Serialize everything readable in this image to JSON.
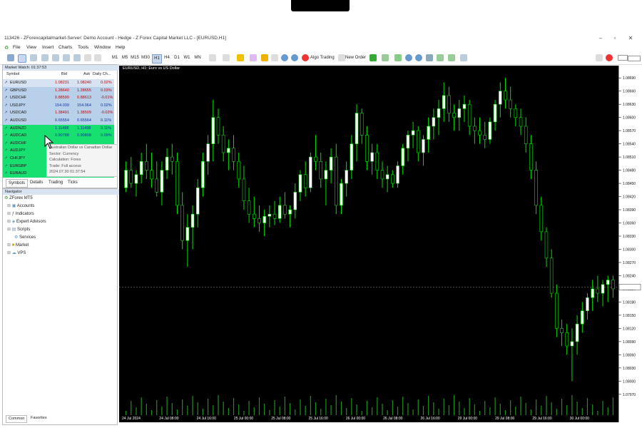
{
  "window": {
    "title": "113426 - ZForexcapitalmarket-Server: Demo Account - Hedge - Z Forex Capital Market LLC - [EURUSD,H1]"
  },
  "menu": [
    "File",
    "View",
    "Insert",
    "Charts",
    "Tools",
    "Window",
    "Help"
  ],
  "toolbar": {
    "timeframes": [
      "M1",
      "M5",
      "M15",
      "M30",
      "H1",
      "H4",
      "D1",
      "W1",
      "MN"
    ],
    "algo": "Algo Trading",
    "new_order": "New Order"
  },
  "market_watch": {
    "title": "Market Watch: 01:37:53",
    "headers": [
      "Symbol",
      "Bid",
      "Ask",
      "Daily Ch..."
    ],
    "rows": [
      {
        "symbol": "EURUSD",
        "bid": "1.08231",
        "ask": "1.08240",
        "change": "0.02%",
        "color": "#d7e3f2",
        "textcolor": "#c00000"
      },
      {
        "symbol": "GBPUSD",
        "bid": "1.28640",
        "ask": "1.28655",
        "change": "0.03%",
        "color": "#b9d0ea",
        "textcolor": "#c00000"
      },
      {
        "symbol": "USDCHF",
        "bid": "0.88599",
        "ask": "0.88613",
        "change": "-0.01%",
        "color": "#b9d0ea",
        "textcolor": "#c00000"
      },
      {
        "symbol": "USDJPY",
        "bid": "154.039",
        "ask": "154.064",
        "change": "0.02%",
        "color": "#b9d0ea",
        "textcolor": "#1030a0"
      },
      {
        "symbol": "USDCAD",
        "bid": "1.38491",
        "ask": "1.38509",
        "change": "-0.02%",
        "color": "#b9d0ea",
        "textcolor": "#c00000"
      },
      {
        "symbol": "AUDUSD",
        "bid": "0.65554",
        "ask": "0.65564",
        "change": "0.11%",
        "color": "#b9d0ea",
        "textcolor": "#1030a0"
      },
      {
        "symbol": "AUDNZD",
        "bid": "1.11488",
        "ask": "1.11498",
        "change": "0.11%",
        "color": "#18e070",
        "textcolor": "#1030a0"
      },
      {
        "symbol": "AUDCAD",
        "bid": "0.90788",
        "ask": "0.90808",
        "change": "0.09%",
        "color": "#18e070",
        "textcolor": "#1030a0"
      },
      {
        "symbol": "AUDCHF",
        "bid": "",
        "ask": "",
        "change": "",
        "color": "#18e070",
        "textcolor": "#1030a0"
      },
      {
        "symbol": "AUDJPY",
        "bid": "",
        "ask": "",
        "change": "",
        "color": "#18e070",
        "textcolor": "#1030a0"
      },
      {
        "symbol": "CHFJPY",
        "bid": "",
        "ask": "",
        "change": "",
        "color": "#18e070",
        "textcolor": "#1030a0"
      },
      {
        "symbol": "EURGBP",
        "bid": "",
        "ask": "",
        "change": "",
        "color": "#18e070",
        "textcolor": "#1030a0"
      },
      {
        "symbol": "EURAUD",
        "bid": "",
        "ask": "",
        "change": "",
        "color": "#18e070",
        "textcolor": "#1030a0"
      }
    ],
    "tooltip": [
      "Australian Dollar vs Canadian Dollar",
      "Sector: Currency",
      "Calculation: Forex",
      "Trade: Full access",
      "2024.07.30 01:37:54"
    ],
    "tabs": [
      "Symbols",
      "Details",
      "Trading",
      "Ticks"
    ]
  },
  "navigator": {
    "title": "Navigator",
    "items": [
      "ZForex MT5",
      "Accounts",
      "Indicators",
      "Expert Advisors",
      "Scripts",
      "Services",
      "Market",
      "VPS"
    ],
    "tabs": [
      "Common",
      "Favorites"
    ]
  },
  "chart": {
    "title": "EURUSD, H1: Euro vs US Dollar",
    "bg": "#000000",
    "bull": "#ffffff",
    "bear": "#000000",
    "wick": "#00e000"
  },
  "chart_data": {
    "type": "candlestick",
    "y_ticks": [
      "1.08690",
      "1.08660",
      "1.08630",
      "1.08600",
      "1.08570",
      "1.08540",
      "1.08510",
      "1.08480",
      "1.08450",
      "1.08420",
      "1.08390",
      "1.08360",
      "1.08330",
      "1.08300",
      "1.08270",
      "1.08240",
      "1.08210",
      "1.08180",
      "1.08150",
      "1.08120",
      "1.08090",
      "1.08060",
      "1.08030",
      "1.08000",
      "1.07970"
    ],
    "x_ticks": [
      "24 Jul 2024",
      "24 Jul 08:00",
      "24 Jul 16:00",
      "25 Jul 00:00",
      "25 Jul 08:00",
      "25 Jul 16:00",
      "26 Jul 00:00",
      "26 Jul 08:00",
      "26 Jul 16:00",
      "29 Jul 00:00",
      "29 Jul 08:00",
      "29 Jul 16:00",
      "30 Jul 00:00"
    ],
    "ylim": [
      1.07955,
      1.08705
    ],
    "ohlc": [
      [
        1.0844,
        1.085,
        1.0843,
        1.0848
      ],
      [
        1.0848,
        1.0851,
        1.0844,
        1.0845
      ],
      [
        1.0845,
        1.0848,
        1.0842,
        1.0847
      ],
      [
        1.0847,
        1.0852,
        1.0845,
        1.085
      ],
      [
        1.085,
        1.0854,
        1.0846,
        1.0848
      ],
      [
        1.0848,
        1.0852,
        1.0844,
        1.0846
      ],
      [
        1.0846,
        1.085,
        1.0842,
        1.0843
      ],
      [
        1.0843,
        1.085,
        1.084,
        1.0848
      ],
      [
        1.0848,
        1.0853,
        1.0846,
        1.0851
      ],
      [
        1.0851,
        1.0854,
        1.0847,
        1.085
      ],
      [
        1.085,
        1.0852,
        1.0838,
        1.084
      ],
      [
        1.084,
        1.0843,
        1.083,
        1.0832
      ],
      [
        1.0832,
        1.0838,
        1.0826,
        1.0835
      ],
      [
        1.0835,
        1.084,
        1.083,
        1.0838
      ],
      [
        1.0838,
        1.0846,
        1.0835,
        1.0844
      ],
      [
        1.0844,
        1.0852,
        1.0842,
        1.085
      ],
      [
        1.085,
        1.0856,
        1.0847,
        1.0854
      ],
      [
        1.0854,
        1.0864,
        1.085,
        1.086
      ],
      [
        1.086,
        1.0862,
        1.0854,
        1.0856
      ],
      [
        1.0856,
        1.0858,
        1.085,
        1.0852
      ],
      [
        1.0852,
        1.0855,
        1.0848,
        1.0853
      ],
      [
        1.0853,
        1.0856,
        1.0848,
        1.085
      ],
      [
        1.085,
        1.0852,
        1.0844,
        1.0846
      ],
      [
        1.0846,
        1.0849,
        1.0839,
        1.0841
      ],
      [
        1.0841,
        1.0844,
        1.0836,
        1.0838
      ],
      [
        1.0838,
        1.0842,
        1.0835,
        1.0837
      ],
      [
        1.0837,
        1.084,
        1.0834,
        1.0836
      ],
      [
        1.0836,
        1.0839,
        1.0833,
        1.08375
      ],
      [
        1.08375,
        1.084,
        1.0835,
        1.0838
      ],
      [
        1.0838,
        1.0841,
        1.08355,
        1.0837
      ],
      [
        1.0837,
        1.0842,
        1.0836,
        1.084
      ],
      [
        1.084,
        1.0843,
        1.0837,
        1.0838
      ],
      [
        1.0838,
        1.084,
        1.0835,
        1.0839
      ],
      [
        1.0839,
        1.0845,
        1.0837,
        1.0843
      ],
      [
        1.0843,
        1.0848,
        1.0841,
        1.0847
      ],
      [
        1.0847,
        1.085,
        1.0842,
        1.0844
      ],
      [
        1.0844,
        1.0852,
        1.0843,
        1.0851
      ],
      [
        1.0851,
        1.0856,
        1.0848,
        1.085
      ],
      [
        1.085,
        1.0852,
        1.0844,
        1.0846
      ],
      [
        1.0846,
        1.085,
        1.084,
        1.0848
      ],
      [
        1.0848,
        1.0853,
        1.0845,
        1.0851
      ],
      [
        1.0851,
        1.0854,
        1.0838,
        1.084
      ],
      [
        1.084,
        1.0846,
        1.0838,
        1.0845
      ],
      [
        1.0845,
        1.085,
        1.0842,
        1.0848
      ],
      [
        1.0848,
        1.0856,
        1.0846,
        1.0854
      ],
      [
        1.0854,
        1.0863,
        1.085,
        1.0861
      ],
      [
        1.0861,
        1.0862,
        1.0854,
        1.0856
      ],
      [
        1.0856,
        1.0858,
        1.0848,
        1.085
      ],
      [
        1.085,
        1.0854,
        1.0847,
        1.0852
      ],
      [
        1.0852,
        1.0854,
        1.0846,
        1.0848
      ],
      [
        1.0848,
        1.085,
        1.0844,
        1.0846
      ],
      [
        1.0846,
        1.0849,
        1.0843,
        1.0847
      ],
      [
        1.0847,
        1.0848,
        1.0844,
        1.0845
      ],
      [
        1.0845,
        1.085,
        1.0844,
        1.0849
      ],
      [
        1.0849,
        1.0854,
        1.0847,
        1.0853
      ],
      [
        1.0853,
        1.0857,
        1.085,
        1.0856
      ],
      [
        1.0856,
        1.0859,
        1.0853,
        1.0857
      ],
      [
        1.0857,
        1.0858,
        1.085,
        1.0852
      ],
      [
        1.0852,
        1.0856,
        1.0849,
        1.0855
      ],
      [
        1.0855,
        1.086,
        1.0852,
        1.0858
      ],
      [
        1.0858,
        1.0862,
        1.0855,
        1.086
      ],
      [
        1.086,
        1.0864,
        1.0856,
        1.0862
      ],
      [
        1.0862,
        1.0868,
        1.0859,
        1.0865
      ],
      [
        1.0865,
        1.0867,
        1.0859,
        1.0861
      ],
      [
        1.0861,
        1.0863,
        1.0857,
        1.086
      ],
      [
        1.086,
        1.0864,
        1.0857,
        1.0862
      ],
      [
        1.0862,
        1.0865,
        1.0859,
        1.0863
      ],
      [
        1.0863,
        1.0864,
        1.0856,
        1.0858
      ],
      [
        1.0858,
        1.086,
        1.0854,
        1.0857
      ],
      [
        1.0857,
        1.086,
        1.0854,
        1.0856
      ],
      [
        1.0856,
        1.0859,
        1.0853,
        1.0855
      ],
      [
        1.0855,
        1.086,
        1.0854,
        1.0859
      ],
      [
        1.0859,
        1.0864,
        1.0857,
        1.0863
      ],
      [
        1.0863,
        1.0868,
        1.086,
        1.0866
      ],
      [
        1.0866,
        1.0869,
        1.0862,
        1.0864
      ],
      [
        1.0864,
        1.0867,
        1.086,
        1.0862
      ],
      [
        1.0862,
        1.0863,
        1.0858,
        1.086
      ],
      [
        1.086,
        1.0862,
        1.0856,
        1.0858
      ],
      [
        1.0858,
        1.086,
        1.0852,
        1.0854
      ],
      [
        1.0854,
        1.0856,
        1.0846,
        1.0848
      ],
      [
        1.0848,
        1.085,
        1.0838,
        1.084
      ],
      [
        1.084,
        1.0842,
        1.0832,
        1.0834
      ],
      [
        1.0834,
        1.0835,
        1.0826,
        1.0828
      ],
      [
        1.0828,
        1.083,
        1.0819,
        1.082
      ],
      [
        1.082,
        1.0822,
        1.081,
        1.0812
      ],
      [
        1.0812,
        1.0814,
        1.0808,
        1.0811
      ],
      [
        1.0811,
        1.0813,
        1.0806,
        1.0808
      ],
      [
        1.0808,
        1.0812,
        1.08,
        1.0809
      ],
      [
        1.0809,
        1.0815,
        1.0806,
        1.0813
      ],
      [
        1.0813,
        1.0818,
        1.0811,
        1.0816
      ],
      [
        1.0816,
        1.082,
        1.0814,
        1.0819
      ],
      [
        1.0819,
        1.0823,
        1.0816,
        1.0821
      ],
      [
        1.0821,
        1.0824,
        1.0818,
        1.082
      ],
      [
        1.082,
        1.0823,
        1.0817,
        1.0822
      ],
      [
        1.0822,
        1.0824,
        1.0818,
        1.0823
      ],
      [
        1.0823,
        1.0824,
        1.0819,
        1.0821
      ]
    ]
  }
}
